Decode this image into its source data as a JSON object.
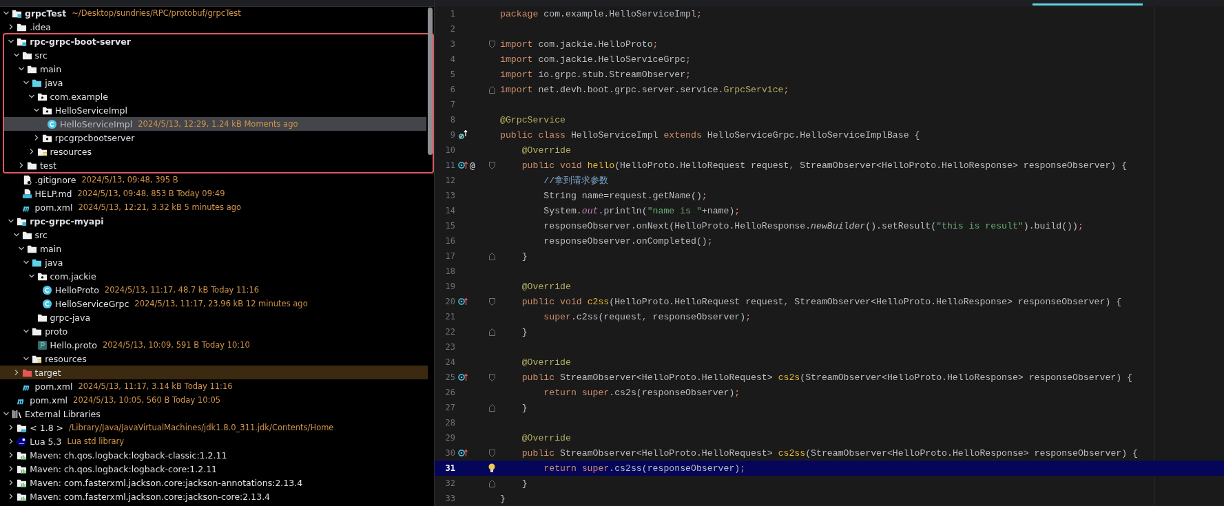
{
  "project_tree": {
    "items": [
      {
        "label": "grpcTest",
        "meta": "~/Desktop/sundries/RPC/protobuf/grpcTest",
        "kind": "module",
        "expanded": true,
        "selected": false,
        "framed": false,
        "children": [
          {
            "label": ".idea",
            "kind": "folder",
            "expanded": false,
            "selected": false,
            "framed": false
          },
          {
            "label": "rpc-grpc-boot-server",
            "kind": "module",
            "expanded": true,
            "selected": false,
            "framed": true,
            "children": [
              {
                "label": "src",
                "kind": "folder",
                "expanded": true,
                "selected": false,
                "framed": true,
                "children": [
                  {
                    "label": "main",
                    "kind": "folder",
                    "expanded": true,
                    "selected": false,
                    "children": [
                      {
                        "label": "java",
                        "kind": "source-folder",
                        "expanded": true,
                        "selected": false,
                        "children": [
                          {
                            "label": "com.example",
                            "kind": "package",
                            "expanded": true,
                            "selected": false,
                            "children": [
                              {
                                "label": "HelloServiceImpl",
                                "kind": "package",
                                "expanded": true,
                                "selected": false,
                                "children": [
                                  {
                                    "label": "HelloServiceImpl",
                                    "meta": "2024/5/13, 12:29, 1.24 kB Moments ago",
                                    "kind": "class",
                                    "selected": true
                                  }
                                ]
                              },
                              {
                                "label": "rpcgrpcbootserver",
                                "kind": "package",
                                "expanded": false,
                                "selected": false
                              }
                            ]
                          },
                          {
                            "label": "resources",
                            "kind": "resources",
                            "expanded": false,
                            "selected": false
                          }
                        ]
                      }
                    ]
                  },
                  {
                    "label": "test",
                    "kind": "folder",
                    "expanded": false,
                    "selected": false
                  }
                ]
              },
              {
                "label": ".gitignore",
                "meta": "2024/5/13, 09:48, 395 B",
                "kind": "ignore-file",
                "selected": false,
                "framed": false
              },
              {
                "label": "HELP.md",
                "meta": "2024/5/13, 09:48, 853 B Today 09:49",
                "kind": "md-file",
                "selected": false,
                "framed": false
              },
              {
                "label": "pom.xml",
                "meta": "2024/5/13, 12:21, 3.32 kB 5 minutes ago",
                "kind": "maven-file",
                "selected": false,
                "framed": false
              }
            ]
          },
          {
            "label": "rpc-grpc-myapi",
            "kind": "module",
            "expanded": true,
            "selected": false,
            "framed": false,
            "children": [
              {
                "label": "src",
                "kind": "folder",
                "expanded": true,
                "selected": false,
                "children": [
                  {
                    "label": "main",
                    "kind": "folder",
                    "expanded": true,
                    "selected": false,
                    "children": [
                      {
                        "label": "java",
                        "kind": "source-folder",
                        "expanded": true,
                        "selected": false,
                        "children": [
                          {
                            "label": "com.jackie",
                            "kind": "package",
                            "expanded": true,
                            "selected": false,
                            "children": [
                              {
                                "label": "HelloProto",
                                "meta": "2024/5/13, 11:17, 48.7 kB Today 11:16",
                                "kind": "class-file",
                                "selected": false
                              },
                              {
                                "label": "HelloServiceGrpc",
                                "meta": "2024/5/13, 11:17, 23.96 kB 12 minutes ago",
                                "kind": "class-file",
                                "selected": false
                              }
                            ]
                          },
                          {
                            "label": "grpc-java",
                            "kind": "folder",
                            "selected": false
                          }
                        ]
                      },
                      {
                        "label": "proto",
                        "kind": "folder",
                        "expanded": true,
                        "selected": false,
                        "children": [
                          {
                            "label": "Hello.proto",
                            "meta": "2024/5/13, 10:09, 591 B Today 10:10",
                            "kind": "proto-file",
                            "selected": false
                          }
                        ]
                      },
                      {
                        "label": "resources",
                        "kind": "resources",
                        "expanded": true,
                        "selected": false
                      }
                    ]
                  }
                ]
              },
              {
                "label": "target",
                "kind": "excluded-folder",
                "expanded": false,
                "selected": false
              },
              {
                "label": "pom.xml",
                "meta": "2024/5/13, 11:17, 3.14 kB Today 11:16",
                "kind": "maven-file",
                "selected": false
              }
            ]
          },
          {
            "label": "pom.xml",
            "meta": "2024/5/13, 10:05, 560 B Today 10:05",
            "kind": "maven-file",
            "selected": false,
            "framed": false
          }
        ]
      },
      {
        "label": "External Libraries",
        "kind": "libraries",
        "expanded": true,
        "selected": false,
        "framed": false,
        "children": [
          {
            "label": "< 1.8 >",
            "meta": "/Library/Java/JavaVirtualMachines/jdk1.8.0_311.jdk/Contents/Home",
            "kind": "jdk",
            "expanded": false,
            "selected": false
          },
          {
            "label": "Lua 5.3",
            "meta": "Lua std library",
            "kind": "lua",
            "expanded": false,
            "selected": false
          },
          {
            "label": "Maven: ch.qos.logback:logback-classic:1.2.11",
            "kind": "maven-lib",
            "expanded": false,
            "selected": false
          },
          {
            "label": "Maven: ch.qos.logback:logback-core:1.2.11",
            "kind": "maven-lib",
            "expanded": false,
            "selected": false
          },
          {
            "label": "Maven: com.fasterxml.jackson.core:jackson-annotations:2.13.4",
            "kind": "maven-lib",
            "expanded": false,
            "selected": false
          },
          {
            "label": "Maven: com.fasterxml.jackson.core:jackson-core:2.13.4",
            "kind": "maven-lib",
            "expanded": false,
            "selected": false
          }
        ]
      }
    ]
  },
  "editor": {
    "lines": [
      {
        "number": "1",
        "tokens": [
          {
            "kind": "kw",
            "text": "package "
          },
          {
            "kind": "plain",
            "text": "com.example.HelloServiceImpl"
          },
          {
            "kind": "punct",
            "text": ";"
          }
        ]
      },
      {
        "number": "2"
      },
      {
        "number": "3",
        "fold_start": true,
        "tokens": [
          {
            "kind": "kw",
            "text": "import "
          },
          {
            "kind": "plain",
            "text": "com.jackie.HelloProto"
          },
          {
            "kind": "punct",
            "text": ";"
          }
        ]
      },
      {
        "number": "4",
        "tokens": [
          {
            "kind": "kw",
            "text": "import "
          },
          {
            "kind": "plain",
            "text": "com.jackie.HelloServiceGrpc"
          },
          {
            "kind": "punct",
            "text": ";"
          }
        ]
      },
      {
        "number": "5",
        "tokens": [
          {
            "kind": "kw",
            "text": "import "
          },
          {
            "kind": "plain",
            "text": "io.grpc.stub.StreamObserver"
          },
          {
            "kind": "punct",
            "text": ";"
          }
        ]
      },
      {
        "number": "6",
        "fold_end": true,
        "tokens": [
          {
            "kind": "kw",
            "text": "import "
          },
          {
            "kind": "plain",
            "text": "net.devh.boot.grpc.server.service."
          },
          {
            "kind": "anno",
            "text": "GrpcService"
          },
          {
            "kind": "punct",
            "text": ";"
          }
        ]
      },
      {
        "number": "7"
      },
      {
        "number": "8",
        "tokens": [
          {
            "kind": "anno",
            "text": "@GrpcService"
          }
        ]
      },
      {
        "number": "9",
        "marks": [
          {
            "kind": "implemented"
          }
        ],
        "tokens": [
          {
            "kind": "kw",
            "text": "public class "
          },
          {
            "kind": "plain",
            "text": "HelloServiceImpl "
          },
          {
            "kind": "kw",
            "text": "extends "
          },
          {
            "kind": "plain",
            "text": "HelloServiceGrpc.HelloServiceImplBase {"
          }
        ]
      },
      {
        "number": "10",
        "tokens": [
          {
            "kind": "anno",
            "text": "    @Override"
          }
        ]
      },
      {
        "number": "11",
        "marks": [
          {
            "kind": "override"
          }
        ],
        "gutter_text": "@",
        "fold_start": true,
        "tokens": [
          {
            "kind": "kw",
            "text": "    public void "
          },
          {
            "kind": "fn",
            "text": "hello"
          },
          {
            "kind": "plain",
            "text": "(HelloProto.HelloRequest request"
          },
          {
            "kind": "punct",
            "text": ", "
          },
          {
            "kind": "plain",
            "text": "StreamObserver<HelloProto.HelloResponse> responseObserver) {"
          }
        ]
      },
      {
        "number": "12",
        "tokens": [
          {
            "kind": "comment",
            "text": "        //拿到请求参数"
          }
        ]
      },
      {
        "number": "13",
        "tokens": [
          {
            "kind": "plain",
            "text": "        String name=request.getName()"
          },
          {
            "kind": "punct",
            "text": ";"
          }
        ]
      },
      {
        "number": "14",
        "tokens": [
          {
            "kind": "plain",
            "text": "        System."
          },
          {
            "kind": "field",
            "text": "out"
          },
          {
            "kind": "plain",
            "text": ".println("
          },
          {
            "kind": "str",
            "text": "\"name is \""
          },
          {
            "kind": "plain",
            "text": "+name)"
          },
          {
            "kind": "punct",
            "text": ";"
          }
        ]
      },
      {
        "number": "15",
        "tokens": [
          {
            "kind": "plain",
            "text": "        responseObserver.onNext(HelloProto.HelloResponse."
          },
          {
            "kind": "static",
            "text": "newBuilder"
          },
          {
            "kind": "plain",
            "text": "().setResult("
          },
          {
            "kind": "str",
            "text": "\"this is result\""
          },
          {
            "kind": "plain",
            "text": ").build())"
          },
          {
            "kind": "punct",
            "text": ";"
          }
        ]
      },
      {
        "number": "16",
        "tokens": [
          {
            "kind": "plain",
            "text": "        responseObserver.onCompleted()"
          },
          {
            "kind": "punct",
            "text": ";"
          }
        ]
      },
      {
        "number": "17",
        "fold_end": true,
        "tokens": [
          {
            "kind": "plain",
            "text": "    }"
          }
        ]
      },
      {
        "number": "18"
      },
      {
        "number": "19",
        "tokens": [
          {
            "kind": "anno",
            "text": "    @Override"
          }
        ]
      },
      {
        "number": "20",
        "marks": [
          {
            "kind": "override"
          }
        ],
        "fold_start": true,
        "tokens": [
          {
            "kind": "kw",
            "text": "    public void "
          },
          {
            "kind": "fn",
            "text": "c2ss"
          },
          {
            "kind": "plain",
            "text": "(HelloProto.HelloRequest request"
          },
          {
            "kind": "punct",
            "text": ", "
          },
          {
            "kind": "plain",
            "text": "StreamObserver<HelloProto.HelloResponse> responseObserver) {"
          }
        ]
      },
      {
        "number": "21",
        "tokens": [
          {
            "kind": "kw",
            "text": "        super"
          },
          {
            "kind": "plain",
            "text": ".c2ss(request"
          },
          {
            "kind": "punct",
            "text": ", "
          },
          {
            "kind": "plain",
            "text": "responseObserver)"
          },
          {
            "kind": "punct",
            "text": ";"
          }
        ]
      },
      {
        "number": "22",
        "fold_end": true,
        "tokens": [
          {
            "kind": "plain",
            "text": "    }"
          }
        ]
      },
      {
        "number": "23"
      },
      {
        "number": "24",
        "tokens": [
          {
            "kind": "anno",
            "text": "    @Override"
          }
        ]
      },
      {
        "number": "25",
        "marks": [
          {
            "kind": "override"
          }
        ],
        "fold_start": true,
        "tokens": [
          {
            "kind": "kw",
            "text": "    public "
          },
          {
            "kind": "plain",
            "text": "StreamObserver<HelloProto.HelloRequest> "
          },
          {
            "kind": "fn",
            "text": "cs2s"
          },
          {
            "kind": "plain",
            "text": "(StreamObserver<HelloProto.HelloResponse> responseObserver) {"
          }
        ]
      },
      {
        "number": "26",
        "tokens": [
          {
            "kind": "kw",
            "text": "        return super"
          },
          {
            "kind": "plain",
            "text": ".cs2s(responseObserver)"
          },
          {
            "kind": "punct",
            "text": ";"
          }
        ]
      },
      {
        "number": "27",
        "fold_end": true,
        "tokens": [
          {
            "kind": "plain",
            "text": "    }"
          }
        ]
      },
      {
        "number": "28"
      },
      {
        "number": "29",
        "tokens": [
          {
            "kind": "anno",
            "text": "    @Override"
          }
        ]
      },
      {
        "number": "30",
        "marks": [
          {
            "kind": "override"
          }
        ],
        "fold_start": true,
        "tokens": [
          {
            "kind": "kw",
            "text": "    public "
          },
          {
            "kind": "plain",
            "text": "StreamObserver<HelloProto.HelloRequest> "
          },
          {
            "kind": "fn",
            "text": "cs2ss"
          },
          {
            "kind": "plain",
            "text": "(StreamObserver<HelloProto.HelloResponse> responseObserver) {"
          }
        ]
      },
      {
        "number": "31",
        "current": true,
        "bulb": true,
        "tokens": [
          {
            "kind": "kw",
            "text": "        return super"
          },
          {
            "kind": "plain",
            "text": ".cs2ss(responseObserver)"
          },
          {
            "kind": "punct",
            "text": ";"
          }
        ]
      },
      {
        "number": "32",
        "fold_end": true,
        "tokens": [
          {
            "kind": "plain",
            "text": "    }"
          }
        ]
      },
      {
        "number": "33",
        "tokens": [
          {
            "kind": "plain",
            "text": "}"
          }
        ]
      }
    ]
  }
}
